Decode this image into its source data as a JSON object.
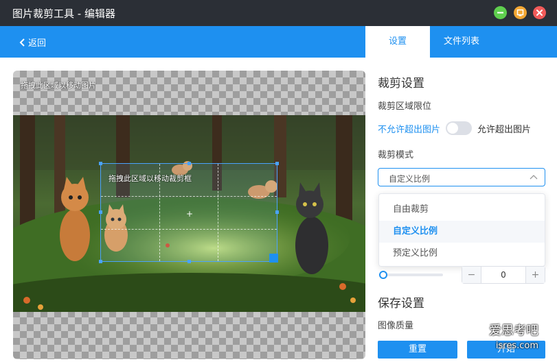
{
  "window": {
    "title": "图片裁剪工具 - 编辑器"
  },
  "header": {
    "back_label": "返回"
  },
  "tabs": [
    {
      "label": "设置",
      "active": true
    },
    {
      "label": "文件列表",
      "active": false
    }
  ],
  "canvas": {
    "image_hint": "拖拽此区域以移动图片",
    "crop_hint": "拖拽此区域以移动裁剪框",
    "center_mark": "+"
  },
  "crop_settings": {
    "section_title": "裁剪设置",
    "limit_label": "裁剪区域限位",
    "limit_off_label": "不允许超出图片",
    "limit_on_label": "允许超出图片",
    "limit_enabled": false,
    "mode_label": "裁剪模式",
    "mode_selected": "自定义比例",
    "mode_options": [
      "自由裁剪",
      "自定义比例",
      "预定义比例"
    ],
    "stepper_value": "0",
    "stepper_minus": "−",
    "stepper_plus": "+"
  },
  "save_settings": {
    "section_title": "保存设置",
    "quality_label": "图像质量"
  },
  "buttons": {
    "reset": "重置",
    "start": "开始"
  },
  "watermark": {
    "line1": "爱思考吧",
    "line2": "isres.com"
  },
  "colors": {
    "accent": "#1e90f0",
    "titlebar": "#2b2f36"
  }
}
